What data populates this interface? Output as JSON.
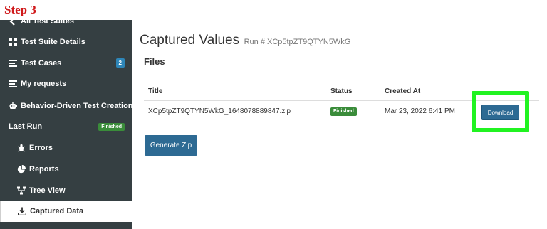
{
  "step_label": "Step 3",
  "sidebar": {
    "items": [
      {
        "label": "All Test Suites",
        "icon": "chevron-left-icon"
      },
      {
        "label": "Test Suite Details",
        "icon": "grid-icon"
      },
      {
        "label": "Test Cases",
        "icon": "list-icon",
        "badge": "2"
      },
      {
        "label": "My requests",
        "icon": "list-icon"
      },
      {
        "label": "Behavior-Driven Test Creation",
        "icon": "robot-icon"
      },
      {
        "label": "Last Run",
        "status": "Finished"
      },
      {
        "label": "Errors",
        "icon": "bug-icon"
      },
      {
        "label": "Reports",
        "icon": "pie-chart-icon"
      },
      {
        "label": "Tree View",
        "icon": "sitemap-icon"
      },
      {
        "label": "Captured Data",
        "icon": "download-icon"
      }
    ]
  },
  "main": {
    "title": "Captured Values",
    "run_label": "Run # XCp5tpZT9QTYN5WkG",
    "files_heading": "Files",
    "table": {
      "headers": {
        "title": "Title",
        "status": "Status",
        "created_at": "Created At"
      },
      "rows": [
        {
          "title": "XCp5tpZT9QTYN5WkG_1648078889847.zip",
          "status": "Finished",
          "created_at": "Mar 23, 2022 6:41 PM",
          "action": "Download"
        }
      ]
    },
    "generate_zip_label": "Generate Zip"
  },
  "colors": {
    "sidebar_bg": "#353f42",
    "accent_button": "#2d6a93",
    "status_green": "#3a8c3a",
    "highlight_green": "#21f321",
    "step_red": "#d0191b"
  }
}
